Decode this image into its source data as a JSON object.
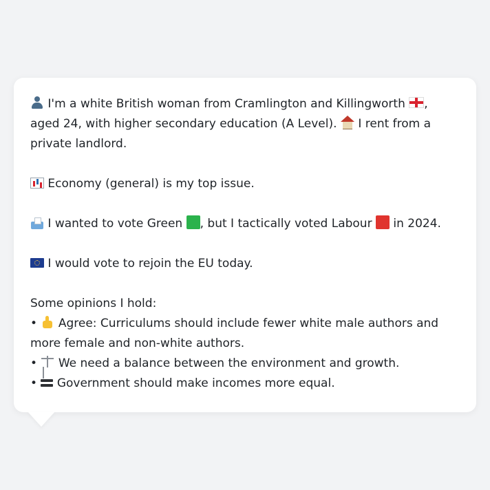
{
  "message": {
    "intro": {
      "icon": "person-silhouette-icon",
      "part1": " I'm a white British woman from Cramlington and Killingworth ",
      "flag_icon": "england-flag-icon",
      "part2": ", aged 24, with higher secondary education (A Level). ",
      "house_icon": "house-icon",
      "part3": " I rent from a private landlord."
    },
    "issue": {
      "icon": "chart-icon",
      "text": " Economy (general) is my top issue."
    },
    "vote": {
      "icon": "ballot-box-icon",
      "part1": " I wanted to vote Green ",
      "green_square_icon": "green-square-icon",
      "part2": ", but I tactically voted Labour ",
      "red_square_icon": "red-square-icon",
      "part3": " in 2024."
    },
    "eu": {
      "icon": "eu-flag-icon",
      "text": " I would vote to rejoin the EU today."
    },
    "opinions": {
      "heading": "Some opinions I hold:",
      "items": [
        {
          "bullet": "• ",
          "icon": "thumbs-up-icon",
          "text": " Agree: Curriculums should include fewer white male authors and more female and non-white authors."
        },
        {
          "bullet": "• ",
          "icon": "balance-scale-icon",
          "text": " We need a balance between the environment and growth."
        },
        {
          "bullet": "• ",
          "icon": "heavy-equals-icon",
          "text": " Government should make incomes more equal."
        }
      ]
    }
  },
  "colors": {
    "background": "#f2f3f5",
    "bubble": "#ffffff",
    "text": "#1f2328",
    "green": "#2bb24c",
    "red": "#e0342e"
  }
}
